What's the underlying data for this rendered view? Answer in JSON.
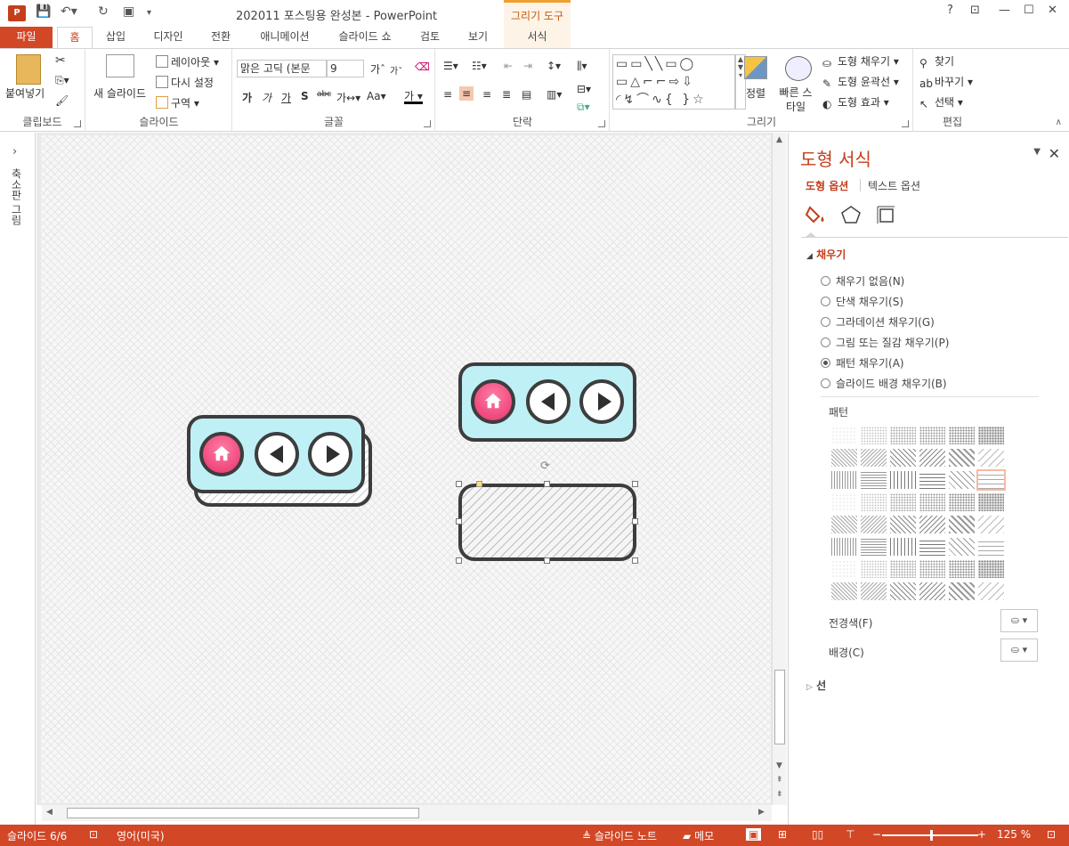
{
  "app": {
    "doc_title": "202011 포스팅용 완성본 - PowerPoint",
    "context_tab_group": "그리기 도구",
    "help": "?",
    "ppt_logo": "P"
  },
  "tabs": [
    "파일",
    "홈",
    "삽입",
    "디자인",
    "전환",
    "애니메이션",
    "슬라이드 쇼",
    "검토",
    "보기",
    "서식"
  ],
  "ribbon": {
    "clipboard": {
      "paste": "붙여넣기",
      "label": "클립보드"
    },
    "slides": {
      "new_slide": "새 슬라이드",
      "layout": "레이아웃",
      "reset": "다시 설정",
      "section": "구역",
      "label": "슬라이드"
    },
    "font": {
      "font_name": "맑은 고딕 (본문",
      "font_size": "9",
      "label": "글꼴"
    },
    "paragraph": {
      "label": "단락"
    },
    "drawing": {
      "arrange": "정렬",
      "quick_styles": "빠른 스타일",
      "shape_fill": "도형 채우기",
      "shape_outline": "도형 윤곽선",
      "shape_effects": "도형 효과",
      "label": "그리기"
    },
    "editing": {
      "find": "찾기",
      "replace": "바꾸기",
      "select": "선택",
      "label": "편집"
    }
  },
  "left_pane": {
    "label": "축소판 그림"
  },
  "format_pane": {
    "title": "도형 서식",
    "tab_shape": "도형 옵션",
    "tab_text": "텍스트 옵션",
    "section_fill": "채우기",
    "fill_options": [
      {
        "label": "채우기 없음(N)",
        "checked": false
      },
      {
        "label": "단색 채우기(S)",
        "checked": false
      },
      {
        "label": "그라데이션 채우기(G)",
        "checked": false
      },
      {
        "label": "그림 또는 질감 채우기(P)",
        "checked": false
      },
      {
        "label": "패턴 채우기(A)",
        "checked": true
      },
      {
        "label": "슬라이드 배경 채우기(B)",
        "checked": false
      }
    ],
    "pattern_label": "패턴",
    "foreground": "전경색(F)",
    "background": "배경(C)",
    "section_line": "선",
    "selected_pattern_index": 17
  },
  "statusbar": {
    "slide": "슬라이드 6/6",
    "language": "영어(미국)",
    "notes": "슬라이드 노트",
    "comments": "메모",
    "zoom": "125 %"
  },
  "colors": {
    "accent": "#d24726",
    "nav_fill": "#bff0f6",
    "home_button": "#e8336e"
  }
}
